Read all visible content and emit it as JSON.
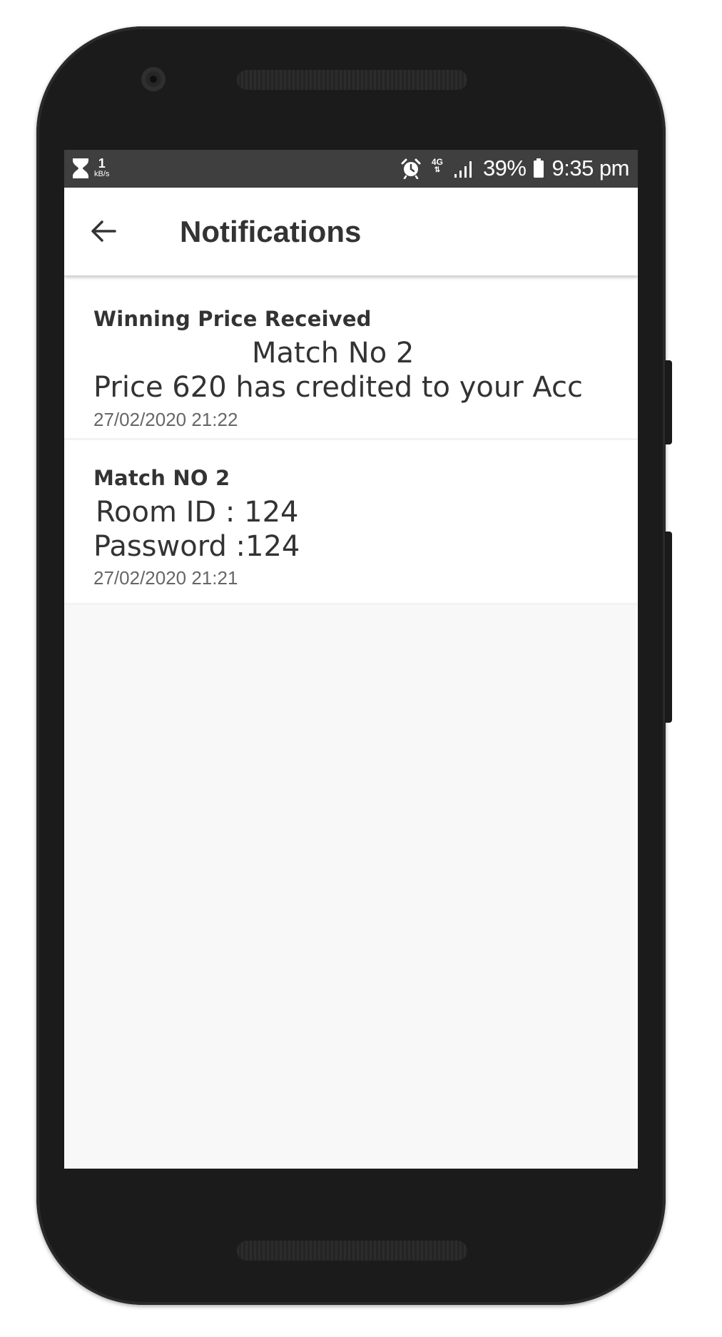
{
  "status_bar": {
    "data_speed_value": "1",
    "data_speed_unit": "kB/s",
    "network_type": "4G",
    "battery_percent": "39%",
    "time": "9:35 pm",
    "icons": [
      "hourglass-icon",
      "alarm-icon",
      "network-4g-icon",
      "signal-icon",
      "battery-icon"
    ]
  },
  "app_bar": {
    "title": "Notifications",
    "back_icon": "arrow-left-icon"
  },
  "notifications": [
    {
      "title": "Winning Price Received",
      "lines": [
        "Match No 2",
        "Price 620 has credited to your Acc"
      ],
      "timestamp": "27/02/2020 21:22"
    },
    {
      "title": "Match NO 2",
      "lines": [
        "Room ID : 124",
        "Password :124"
      ],
      "timestamp": "27/02/2020 21:21"
    }
  ],
  "colors": {
    "status_bar_bg": "#3f3f3f",
    "app_bar_bg": "#ffffff",
    "screen_bg": "#f8f8f8",
    "text_primary": "#333333",
    "text_secondary": "#666666",
    "phone_body": "#1b1b1b"
  }
}
